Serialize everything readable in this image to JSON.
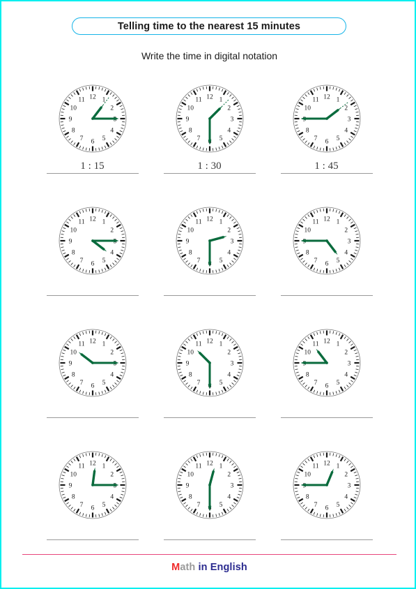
{
  "page": {
    "border_color": "#00efef",
    "background": "#ffffff"
  },
  "header": {
    "title": "Telling time to the nearest 15 minutes",
    "title_border_color": "#16b4e8",
    "instruction": "Write the time in digital notation"
  },
  "clock_style": {
    "hand_color": "#0a6b3d",
    "face_color": "#ffffff",
    "tick_color": "#1a1a1a",
    "numeral_color": "#1a1a1a",
    "answer_line_color": "#9a9a9a",
    "numerals": [
      "12",
      "1",
      "2",
      "3",
      "4",
      "5",
      "6",
      "7",
      "8",
      "9",
      "10",
      "11"
    ]
  },
  "problems": [
    {
      "id": 1,
      "hour": 1,
      "minute": 15,
      "answer": "1 : 15",
      "answered": true,
      "guide_dots": true
    },
    {
      "id": 2,
      "hour": 1,
      "minute": 30,
      "answer": "1 : 30",
      "answered": true,
      "guide_dots": true
    },
    {
      "id": 3,
      "hour": 1,
      "minute": 45,
      "answer": "1 : 45",
      "answered": true,
      "guide_dots": true
    },
    {
      "id": 4,
      "hour": 4,
      "minute": 15,
      "answer": "",
      "answered": false,
      "guide_dots": false
    },
    {
      "id": 5,
      "hour": 2,
      "minute": 30,
      "answer": "",
      "answered": false,
      "guide_dots": false
    },
    {
      "id": 6,
      "hour": 4,
      "minute": 45,
      "answer": "",
      "answered": false,
      "guide_dots": false
    },
    {
      "id": 7,
      "hour": 10,
      "minute": 15,
      "answer": "",
      "answered": false,
      "guide_dots": false
    },
    {
      "id": 8,
      "hour": 10,
      "minute": 30,
      "answer": "",
      "answered": false,
      "guide_dots": false
    },
    {
      "id": 9,
      "hour": 10,
      "minute": 45,
      "answer": "",
      "answered": false,
      "guide_dots": false
    },
    {
      "id": 10,
      "hour": 12,
      "minute": 15,
      "answer": "",
      "answered": false,
      "guide_dots": false
    },
    {
      "id": 11,
      "hour": 12,
      "minute": 30,
      "answer": "",
      "answered": false,
      "guide_dots": false
    },
    {
      "id": 12,
      "hour": 12,
      "minute": 45,
      "answer": "",
      "answered": false,
      "guide_dots": false
    }
  ],
  "footer": {
    "rule_color": "#e8467c",
    "logo_m": "M",
    "logo_ath": "ath",
    "logo_rest": " in English"
  }
}
